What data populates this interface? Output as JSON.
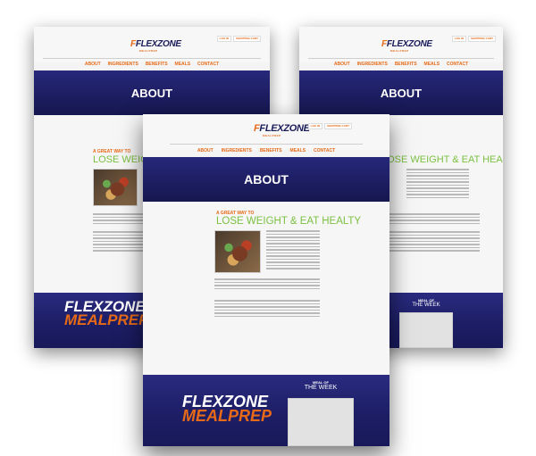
{
  "brand": {
    "name": "FLEXZONE",
    "sub": "MEALPREP",
    "accent": "#e66a17",
    "navy": "#1c1d60",
    "green": "#7bc142"
  },
  "util": {
    "login": "LOG IN",
    "cart": "SHOPPING CART"
  },
  "nav": [
    "ABOUT",
    "INGREDIENTS",
    "BENEFITS",
    "MEALS",
    "CONTACT"
  ],
  "hero_title": "ABOUT",
  "kicker": "A GREAT WAY TO",
  "headline_left": "LOSE WEIGHT & EAT HEALTY",
  "headline_right": "LOSE WEIGHT & EAT HEALTY",
  "headline_front": "LOSE WEIGHT & EAT HEALTY",
  "footer": {
    "logo_main": "FLEXZONE",
    "logo_sub": "MEALPREP",
    "meal_label": "MEAL OF",
    "meal_label2": "THE WEEK"
  }
}
